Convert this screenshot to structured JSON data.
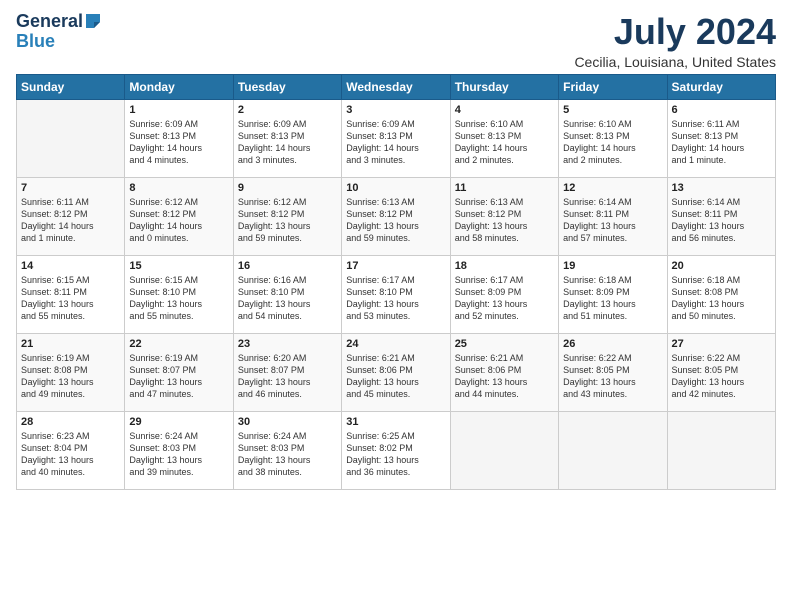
{
  "header": {
    "logo_general": "General",
    "logo_blue": "Blue",
    "title": "July 2024",
    "location": "Cecilia, Louisiana, United States"
  },
  "days_of_week": [
    "Sunday",
    "Monday",
    "Tuesday",
    "Wednesday",
    "Thursday",
    "Friday",
    "Saturday"
  ],
  "weeks": [
    [
      {
        "num": "",
        "info": ""
      },
      {
        "num": "1",
        "info": "Sunrise: 6:09 AM\nSunset: 8:13 PM\nDaylight: 14 hours\nand 4 minutes."
      },
      {
        "num": "2",
        "info": "Sunrise: 6:09 AM\nSunset: 8:13 PM\nDaylight: 14 hours\nand 3 minutes."
      },
      {
        "num": "3",
        "info": "Sunrise: 6:09 AM\nSunset: 8:13 PM\nDaylight: 14 hours\nand 3 minutes."
      },
      {
        "num": "4",
        "info": "Sunrise: 6:10 AM\nSunset: 8:13 PM\nDaylight: 14 hours\nand 2 minutes."
      },
      {
        "num": "5",
        "info": "Sunrise: 6:10 AM\nSunset: 8:13 PM\nDaylight: 14 hours\nand 2 minutes."
      },
      {
        "num": "6",
        "info": "Sunrise: 6:11 AM\nSunset: 8:13 PM\nDaylight: 14 hours\nand 1 minute."
      }
    ],
    [
      {
        "num": "7",
        "info": "Sunrise: 6:11 AM\nSunset: 8:12 PM\nDaylight: 14 hours\nand 1 minute."
      },
      {
        "num": "8",
        "info": "Sunrise: 6:12 AM\nSunset: 8:12 PM\nDaylight: 14 hours\nand 0 minutes."
      },
      {
        "num": "9",
        "info": "Sunrise: 6:12 AM\nSunset: 8:12 PM\nDaylight: 13 hours\nand 59 minutes."
      },
      {
        "num": "10",
        "info": "Sunrise: 6:13 AM\nSunset: 8:12 PM\nDaylight: 13 hours\nand 59 minutes."
      },
      {
        "num": "11",
        "info": "Sunrise: 6:13 AM\nSunset: 8:12 PM\nDaylight: 13 hours\nand 58 minutes."
      },
      {
        "num": "12",
        "info": "Sunrise: 6:14 AM\nSunset: 8:11 PM\nDaylight: 13 hours\nand 57 minutes."
      },
      {
        "num": "13",
        "info": "Sunrise: 6:14 AM\nSunset: 8:11 PM\nDaylight: 13 hours\nand 56 minutes."
      }
    ],
    [
      {
        "num": "14",
        "info": "Sunrise: 6:15 AM\nSunset: 8:11 PM\nDaylight: 13 hours\nand 55 minutes."
      },
      {
        "num": "15",
        "info": "Sunrise: 6:15 AM\nSunset: 8:10 PM\nDaylight: 13 hours\nand 55 minutes."
      },
      {
        "num": "16",
        "info": "Sunrise: 6:16 AM\nSunset: 8:10 PM\nDaylight: 13 hours\nand 54 minutes."
      },
      {
        "num": "17",
        "info": "Sunrise: 6:17 AM\nSunset: 8:10 PM\nDaylight: 13 hours\nand 53 minutes."
      },
      {
        "num": "18",
        "info": "Sunrise: 6:17 AM\nSunset: 8:09 PM\nDaylight: 13 hours\nand 52 minutes."
      },
      {
        "num": "19",
        "info": "Sunrise: 6:18 AM\nSunset: 8:09 PM\nDaylight: 13 hours\nand 51 minutes."
      },
      {
        "num": "20",
        "info": "Sunrise: 6:18 AM\nSunset: 8:08 PM\nDaylight: 13 hours\nand 50 minutes."
      }
    ],
    [
      {
        "num": "21",
        "info": "Sunrise: 6:19 AM\nSunset: 8:08 PM\nDaylight: 13 hours\nand 49 minutes."
      },
      {
        "num": "22",
        "info": "Sunrise: 6:19 AM\nSunset: 8:07 PM\nDaylight: 13 hours\nand 47 minutes."
      },
      {
        "num": "23",
        "info": "Sunrise: 6:20 AM\nSunset: 8:07 PM\nDaylight: 13 hours\nand 46 minutes."
      },
      {
        "num": "24",
        "info": "Sunrise: 6:21 AM\nSunset: 8:06 PM\nDaylight: 13 hours\nand 45 minutes."
      },
      {
        "num": "25",
        "info": "Sunrise: 6:21 AM\nSunset: 8:06 PM\nDaylight: 13 hours\nand 44 minutes."
      },
      {
        "num": "26",
        "info": "Sunrise: 6:22 AM\nSunset: 8:05 PM\nDaylight: 13 hours\nand 43 minutes."
      },
      {
        "num": "27",
        "info": "Sunrise: 6:22 AM\nSunset: 8:05 PM\nDaylight: 13 hours\nand 42 minutes."
      }
    ],
    [
      {
        "num": "28",
        "info": "Sunrise: 6:23 AM\nSunset: 8:04 PM\nDaylight: 13 hours\nand 40 minutes."
      },
      {
        "num": "29",
        "info": "Sunrise: 6:24 AM\nSunset: 8:03 PM\nDaylight: 13 hours\nand 39 minutes."
      },
      {
        "num": "30",
        "info": "Sunrise: 6:24 AM\nSunset: 8:03 PM\nDaylight: 13 hours\nand 38 minutes."
      },
      {
        "num": "31",
        "info": "Sunrise: 6:25 AM\nSunset: 8:02 PM\nDaylight: 13 hours\nand 36 minutes."
      },
      {
        "num": "",
        "info": ""
      },
      {
        "num": "",
        "info": ""
      },
      {
        "num": "",
        "info": ""
      }
    ]
  ]
}
